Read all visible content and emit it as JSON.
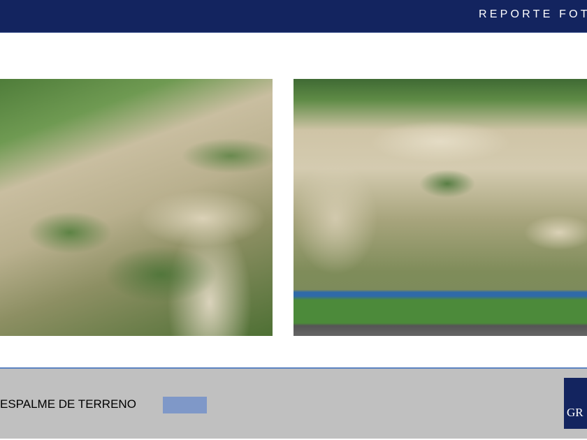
{
  "header": {
    "title": "REPORTE FOTO"
  },
  "photos": [
    {
      "subject": "aerial-view-land-clearing-left"
    },
    {
      "subject": "aerial-view-land-clearing-right"
    }
  ],
  "footer": {
    "label": "ESPALME DE TERRENO",
    "swatch_color": "#7f98c8",
    "logo_text": "GR"
  }
}
